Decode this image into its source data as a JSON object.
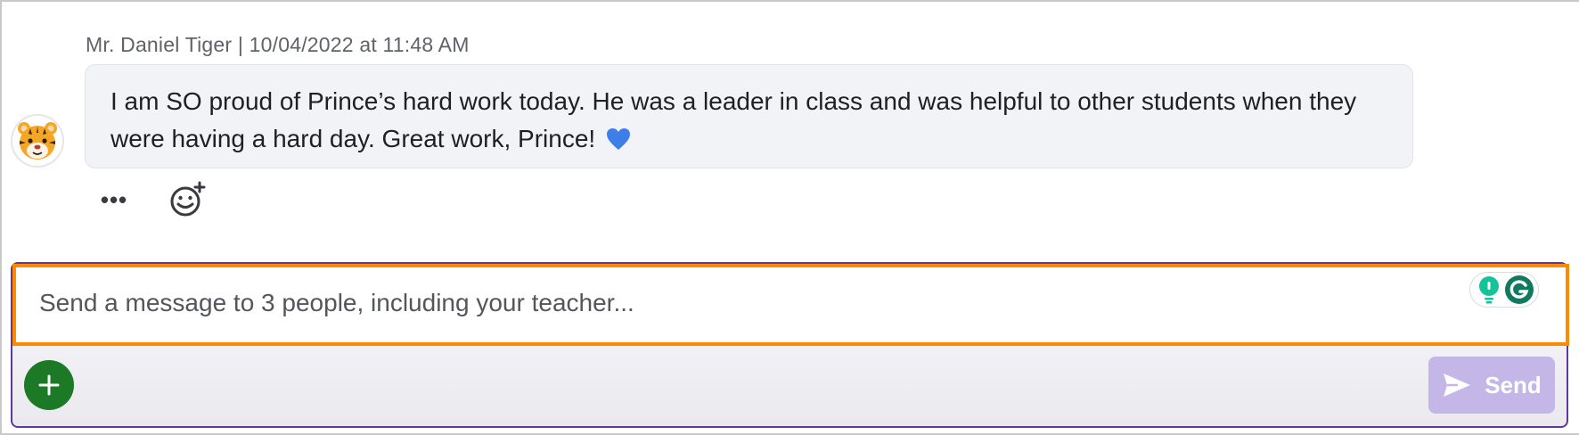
{
  "message": {
    "author": "Mr. Daniel Tiger",
    "separator": "|",
    "timestamp": "10/04/2022 at 11:48 AM",
    "body": "I am SO proud of Prince’s hard work today. He was a leader in class and was helpful to other students when they were having a hard day. Great work, Prince!",
    "avatar_icon": "tiger-face-icon",
    "trailing_emoji_icon": "blue-heart-icon"
  },
  "message_actions": {
    "more_label": "•••",
    "more_icon": "ellipsis-icon",
    "react_icon": "add-reaction-icon"
  },
  "composer": {
    "placeholder": "Send a message to 3 people, including your teacher...",
    "value": "",
    "add_icon": "plus-icon",
    "send_label": "Send",
    "send_icon": "paper-plane-icon",
    "assistant_icons": [
      "lightbulb-icon",
      "grammarly-g-icon"
    ]
  },
  "colors": {
    "focus_outline": "#ff8a00",
    "composer_border": "#5b3a9c",
    "add_button": "#1c7a26",
    "send_button_disabled": "#c4b6e6",
    "bubble_background": "#f2f3f6"
  }
}
